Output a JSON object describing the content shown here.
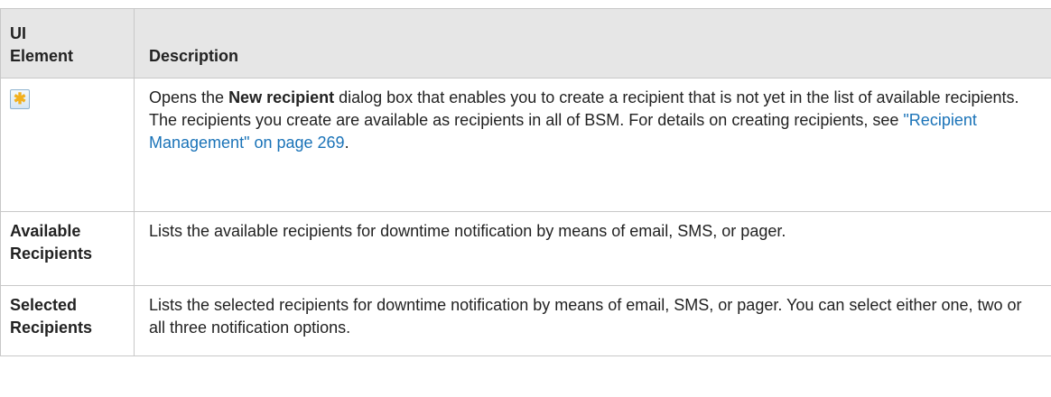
{
  "header": {
    "col1": "UI Element",
    "col1_line1": "UI",
    "col1_line2": "Element",
    "col2": "Description"
  },
  "rows": [
    {
      "element_icon": "new-recipient-icon",
      "desc": {
        "pre": "Opens the ",
        "bold": "New recipient",
        "post": " dialog box that enables you to create a recipient that is not yet in the list of available recipients. The recipients you create are available as recipients in all of BSM. For details on creating recipients, see ",
        "link": "\"Recipient Management\" on page 269",
        "end": "."
      }
    },
    {
      "element_line1": "Available",
      "element_line2": "Recipients",
      "desc": "Lists the available recipients for downtime notification by means of email, SMS, or pager."
    },
    {
      "element_line1": "Selected",
      "element_line2": "Recipients",
      "desc": "Lists the selected recipients for downtime notification by means of email, SMS, or pager. You can select either one, two or all three notification options."
    }
  ],
  "colors": {
    "link": "#1a73b8",
    "header_bg": "#e6e6e6",
    "border": "#c8c8c8",
    "icon_star": "#f2b01e"
  }
}
